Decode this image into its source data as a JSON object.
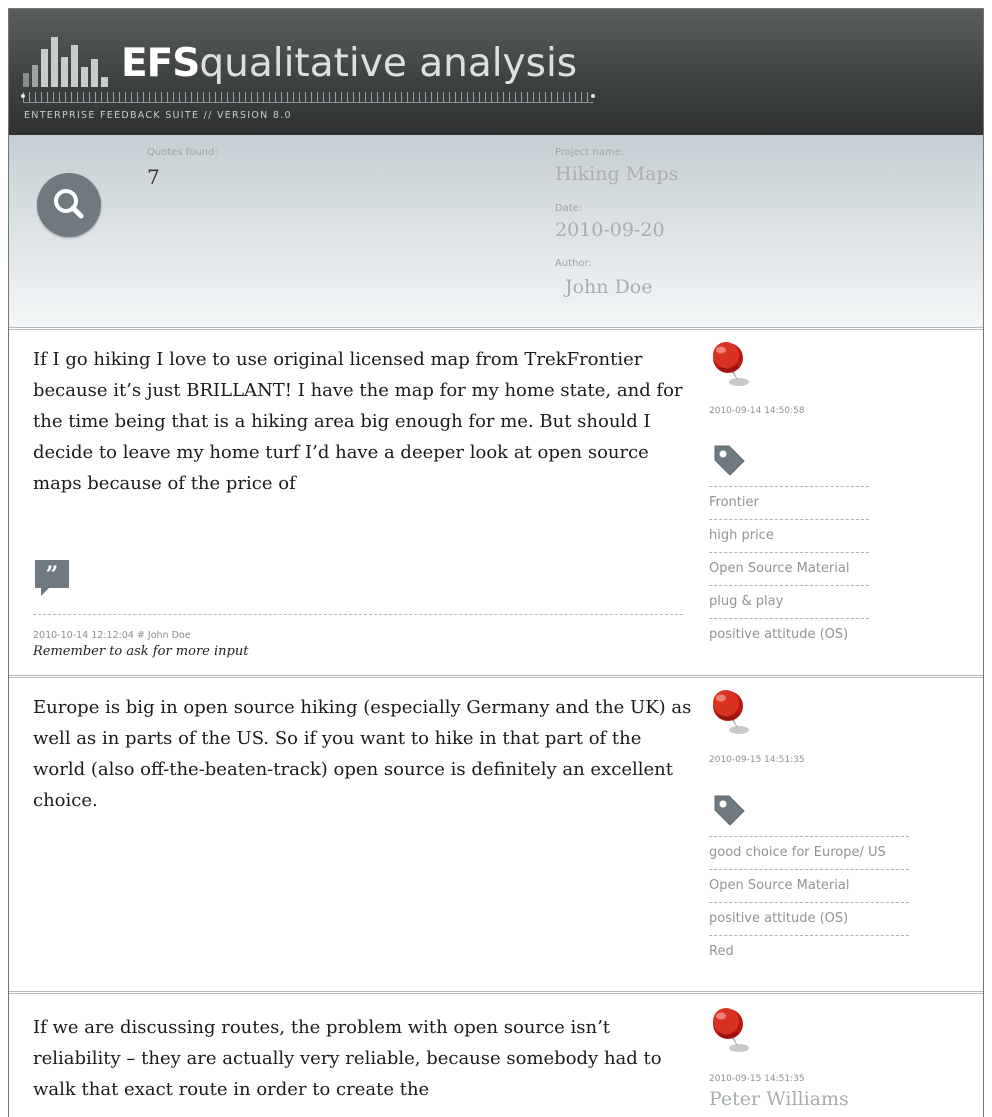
{
  "app": {
    "brand_bold": "EFS",
    "brand_light": "qualitative analysis",
    "subtitle": "ENTERPRISE FEEDBACK SUITE // VERSION 8.0"
  },
  "info": {
    "quotes_label": "Quotes found:",
    "quotes_count": "7",
    "project_label": "Project name:",
    "project_value": "Hiking Maps",
    "date_label": "Date:",
    "date_value": "2010-09-20",
    "author_label": "Author:",
    "author_value": "John Doe"
  },
  "entries": [
    {
      "text": "If I go hiking I love to use original licensed map from TrekFrontier because it’s just BRILLANT! I have the map for my home state, and for the time being that is a hiking area big enough for me. But should I decide to leave my home turf I’d have a deeper look at open source maps because of the price of",
      "timestamp": "2010-09-14 14:50:58",
      "tags": [
        "Frontier",
        "high price",
        "Open Source Material",
        "plug & play",
        "positive attitude (OS)"
      ],
      "comment_meta": "2010-10-14 12:12:04 # John Doe",
      "comment_text": "Remember to ask for more input"
    },
    {
      "text": "Europe is big in open source hiking (especially Germany and the UK) as well as in parts of the US. So if you want to hike in that part of the world (also off-the-beaten-track) open source is definitely an excellent choice.",
      "timestamp": "2010-09-15 14:51:35",
      "tags": [
        "good choice for Europe/ US",
        "Open Source Material",
        "positive attitude (OS)",
        "Red"
      ]
    },
    {
      "text": "If we are discussing routes, the problem with open source isn’t reliability – they are actually very reliable, because somebody had to walk that exact route in order to create the",
      "timestamp": "2010-09-15 14:51:35",
      "author": "Peter Williams"
    }
  ],
  "icons": {
    "search": "search-icon",
    "pin": "pushpin-icon",
    "tag": "tag-icon",
    "comment": "quote-comment-icon"
  },
  "colors": {
    "header_bg": "#3f4243",
    "info_bg": "#dfe5e8",
    "pin_red": "#d42a1e",
    "icon_gray": "#6f7a80"
  }
}
